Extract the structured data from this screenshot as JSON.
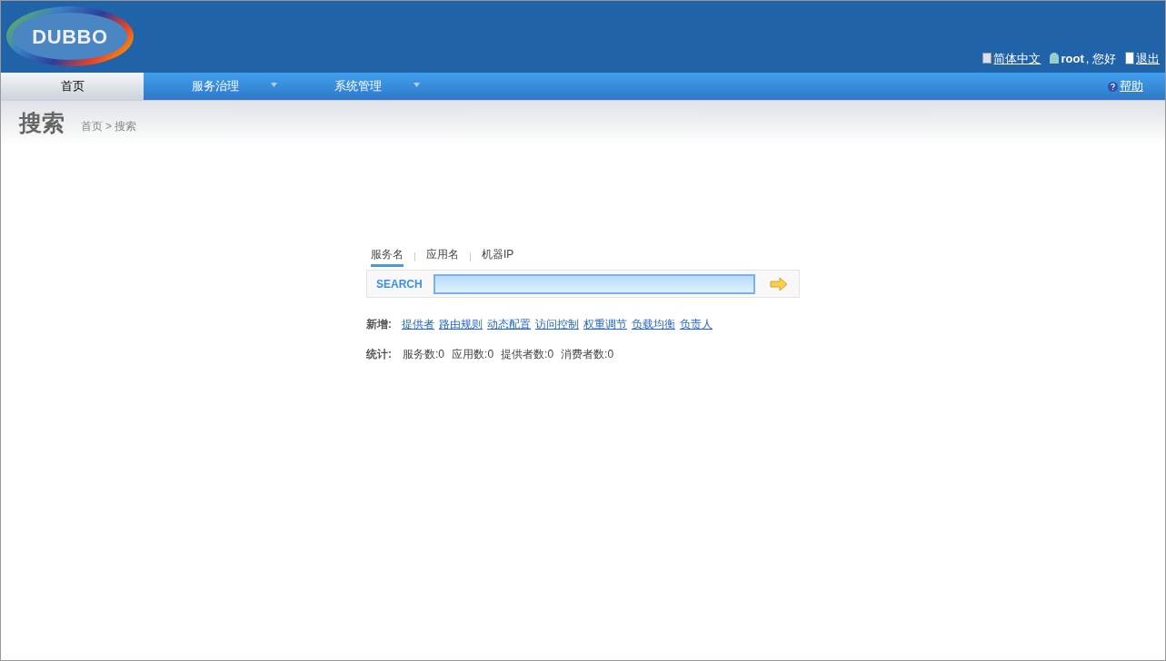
{
  "header": {
    "logo": "DUBBO",
    "language": "简体中文",
    "user": "root",
    "greeting": ", 您好",
    "logout": "退出"
  },
  "nav": {
    "items": [
      {
        "label": "首页",
        "selected": true,
        "dropdown": false
      },
      {
        "label": "服务治理",
        "selected": false,
        "dropdown": true
      },
      {
        "label": "系统管理",
        "selected": false,
        "dropdown": true
      }
    ],
    "help": "帮助"
  },
  "page": {
    "title": "搜索",
    "breadcrumb": [
      {
        "label": "首页"
      },
      {
        "label": "搜索"
      }
    ],
    "separator": ">"
  },
  "search": {
    "tabs": [
      {
        "label": "服务名",
        "selected": true
      },
      {
        "label": "应用名",
        "selected": false
      },
      {
        "label": "机器IP",
        "selected": false
      }
    ],
    "label": "SEARCH"
  },
  "add": {
    "label": "新增:",
    "links": [
      "提供者",
      "路由规则",
      "动态配置",
      "访问控制",
      "权重调节",
      "负载均衡",
      "负责人"
    ]
  },
  "stats": {
    "label": "统计:",
    "items": [
      {
        "name": "服务数:",
        "value": "0"
      },
      {
        "name": "应用数:",
        "value": "0"
      },
      {
        "name": "提供者数:",
        "value": "0"
      },
      {
        "name": "消费者数:",
        "value": "0"
      }
    ]
  }
}
